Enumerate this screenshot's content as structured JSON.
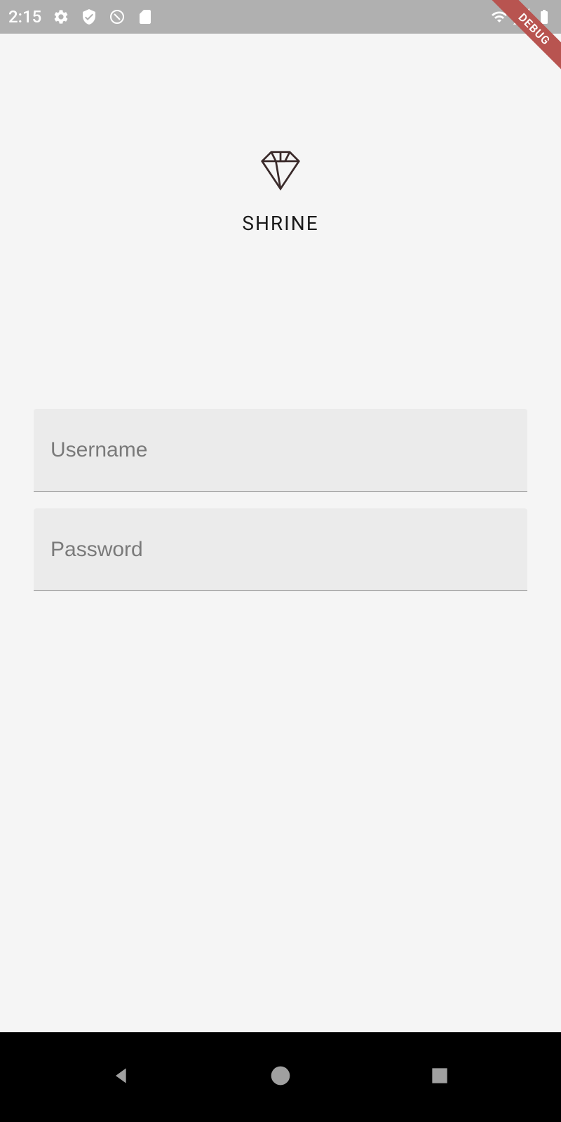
{
  "statusBar": {
    "time": "2:15"
  },
  "debugBanner": {
    "text": "DEBUG"
  },
  "logo": {
    "title": "SHRINE"
  },
  "form": {
    "usernamePlaceholder": "Username",
    "passwordPlaceholder": "Password"
  }
}
